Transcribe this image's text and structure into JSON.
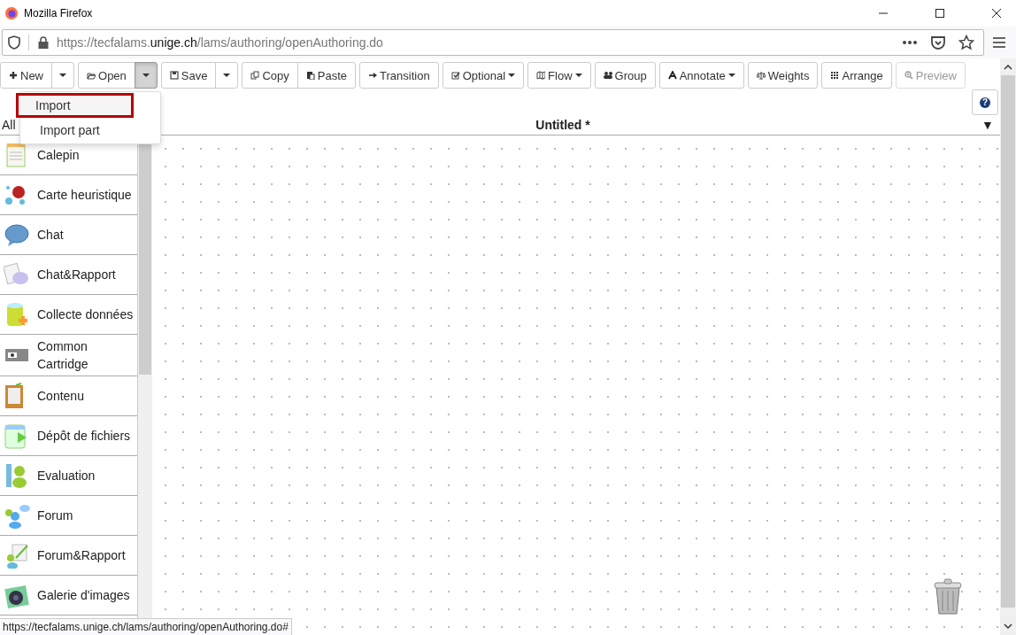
{
  "window": {
    "title": "Mozilla Firefox"
  },
  "address": {
    "prefix": "https://tecfalams.",
    "host": "unige.ch",
    "path": "/lams/authoring/openAuthoring.do"
  },
  "toolbar": [
    {
      "buttons": [
        {
          "kind": "label",
          "label": "New"
        },
        {
          "kind": "caret",
          "pressed": false
        }
      ]
    },
    {
      "buttons": [
        {
          "kind": "label",
          "label": "Open"
        },
        {
          "kind": "caret",
          "pressed": true
        }
      ]
    },
    {
      "buttons": [
        {
          "kind": "label",
          "label": "Save"
        },
        {
          "kind": "caret",
          "pressed": false
        }
      ]
    },
    {
      "buttons": [
        {
          "kind": "label",
          "label": "Copy"
        },
        {
          "kind": "label",
          "label": "Paste"
        }
      ]
    },
    {
      "buttons": [
        {
          "kind": "label",
          "label": "Transition"
        }
      ]
    },
    {
      "buttons": [
        {
          "kind": "menu",
          "label": "Optional"
        }
      ]
    },
    {
      "buttons": [
        {
          "kind": "menu",
          "label": "Flow"
        }
      ]
    },
    {
      "buttons": [
        {
          "kind": "label",
          "label": "Group"
        }
      ]
    },
    {
      "buttons": [
        {
          "kind": "menu",
          "label": "Annotate"
        }
      ]
    },
    {
      "buttons": [
        {
          "kind": "label",
          "label": "Weights"
        }
      ]
    },
    {
      "buttons": [
        {
          "kind": "label",
          "label": "Arrange"
        }
      ]
    },
    {
      "buttons": [
        {
          "kind": "label",
          "label": "Preview",
          "disabled": true
        }
      ]
    }
  ],
  "open_menu": [
    {
      "label": "Import",
      "selected": true
    },
    {
      "label": "Import part",
      "selected": false
    }
  ],
  "help": "?",
  "filter": "All",
  "canvas": {
    "title": "Untitled *",
    "toggle": "▼"
  },
  "sidebar": {
    "items": [
      {
        "label": "Calepin"
      },
      {
        "label": "Carte heuristique"
      },
      {
        "label": "Chat"
      },
      {
        "label": "Chat&Rapport"
      },
      {
        "label": "Collecte données"
      },
      {
        "label": "Common Cartridge"
      },
      {
        "label": "Contenu"
      },
      {
        "label": "Dépôt de fichiers"
      },
      {
        "label": "Evaluation"
      },
      {
        "label": "Forum"
      },
      {
        "label": "Forum&Rapport"
      },
      {
        "label": "Galerie d'images"
      }
    ]
  },
  "status_bar": "https://tecfalams.unige.ch/lams/authoring/openAuthoring.do#"
}
